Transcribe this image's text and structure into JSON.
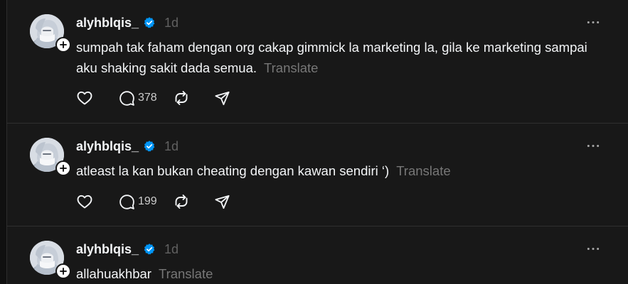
{
  "posts": [
    {
      "username": "alyhblqis_",
      "time": "1d",
      "text": "sumpah tak faham dengan org cakap gimmick la marketing la, gila ke marketing sampai aku shaking sakit dada semua.",
      "translate": "Translate",
      "replies": "378"
    },
    {
      "username": "alyhblqis_",
      "time": "1d",
      "text": "atleast la kan bukan cheating dengan kawan sendiri ‘)",
      "translate": "Translate",
      "replies": "199"
    },
    {
      "username": "alyhblqis_",
      "time": "1d",
      "text": "allahuakhbar",
      "translate": "Translate"
    }
  ],
  "icons": {
    "like": "heart-icon",
    "reply": "comment-icon",
    "repost": "repost-icon",
    "share": "send-icon",
    "more": "more-horizontal-icon",
    "verified": "verified-badge-icon",
    "follow": "plus-icon"
  },
  "colors": {
    "background": "#101010",
    "card": "#181818",
    "text": "#f3f5f7",
    "muted": "#777777",
    "verified": "#0095f6"
  }
}
